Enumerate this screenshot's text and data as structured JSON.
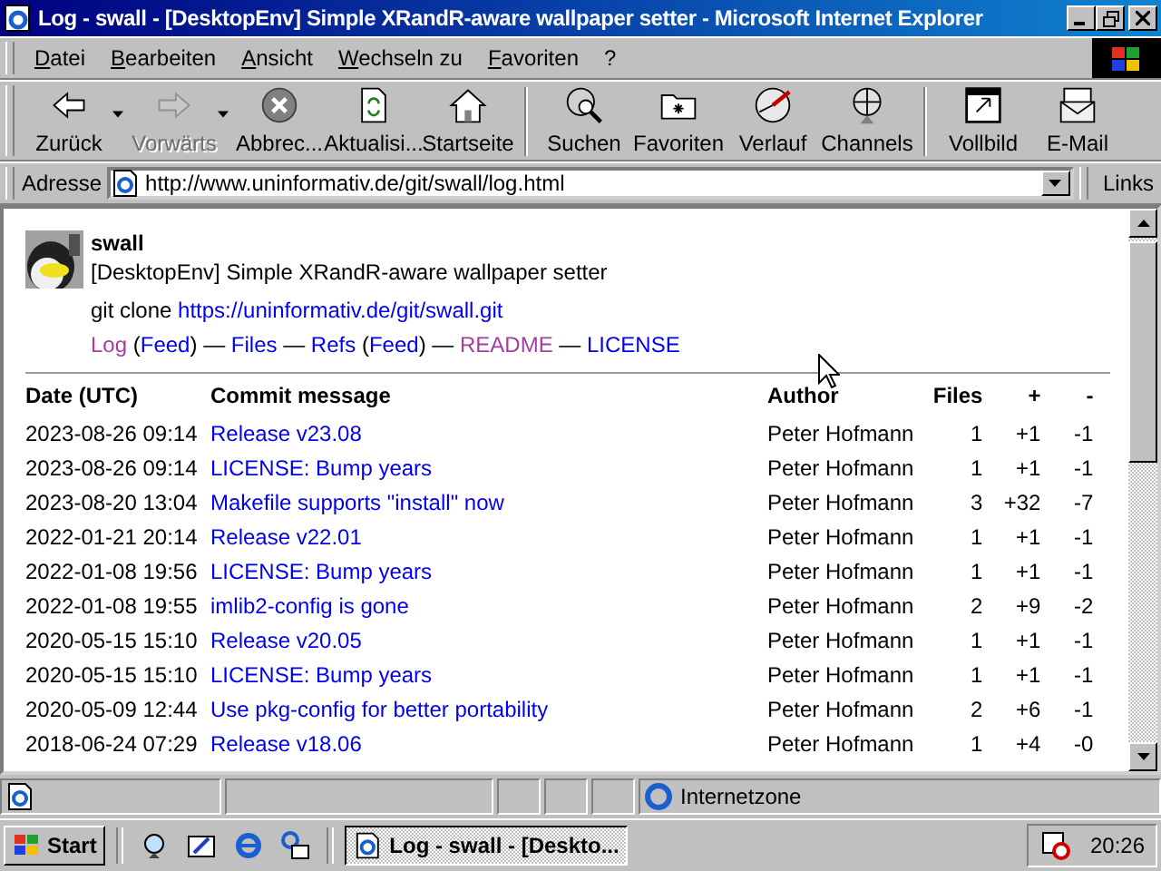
{
  "window": {
    "title": "Log - swall - [DesktopEnv] Simple XRandR-aware wallpaper setter - Microsoft Internet Explorer"
  },
  "menu": [
    "Datei",
    "Bearbeiten",
    "Ansicht",
    "Wechseln zu",
    "Favoriten",
    "?"
  ],
  "toolbar": [
    {
      "label": "Zurück",
      "disabled": false,
      "dropdown": true
    },
    {
      "label": "Vorwärts",
      "disabled": true,
      "dropdown": true
    },
    {
      "label": "Abbrec...",
      "disabled": false
    },
    {
      "label": "Aktualisi...",
      "disabled": false
    },
    {
      "label": "Startseite",
      "disabled": false
    },
    {
      "label": "Suchen",
      "disabled": false,
      "group_start": true
    },
    {
      "label": "Favoriten",
      "disabled": false
    },
    {
      "label": "Verlauf",
      "disabled": false
    },
    {
      "label": "Channels",
      "disabled": false
    },
    {
      "label": "Vollbild",
      "disabled": false,
      "group_start": true
    },
    {
      "label": "E-Mail",
      "disabled": false
    }
  ],
  "address_bar": {
    "label": "Adresse",
    "value": "http://www.uninformativ.de/git/swall/log.html",
    "links": "Links"
  },
  "page": {
    "repo_name": "swall",
    "description": "[DesktopEnv] Simple XRandR-aware wallpaper setter",
    "clone_label": "git clone ",
    "clone_url": "https://uninformativ.de/git/swall.git",
    "nav": [
      {
        "text": "Log",
        "kind": "visited"
      },
      {
        "text": " (",
        "kind": "plain"
      },
      {
        "text": "Feed",
        "kind": "link"
      },
      {
        "text": ") — ",
        "kind": "plain"
      },
      {
        "text": "Files",
        "kind": "link"
      },
      {
        "text": " — ",
        "kind": "plain"
      },
      {
        "text": "Refs",
        "kind": "link"
      },
      {
        "text": " (",
        "kind": "plain"
      },
      {
        "text": "Feed",
        "kind": "link"
      },
      {
        "text": ") — ",
        "kind": "plain"
      },
      {
        "text": "README",
        "kind": "visited"
      },
      {
        "text": " — ",
        "kind": "plain"
      },
      {
        "text": "LICENSE",
        "kind": "link"
      }
    ],
    "table": {
      "columns": [
        "Date (UTC)",
        "Commit message",
        "Author",
        "Files",
        "+",
        "-"
      ],
      "rows": [
        [
          "2023-08-26 09:14",
          "Release v23.08",
          "Peter Hofmann",
          "1",
          "+1",
          "-1"
        ],
        [
          "2023-08-26 09:14",
          "LICENSE: Bump years",
          "Peter Hofmann",
          "1",
          "+1",
          "-1"
        ],
        [
          "2023-08-20 13:04",
          "Makefile supports \"install\" now",
          "Peter Hofmann",
          "3",
          "+32",
          "-7"
        ],
        [
          "2022-01-21 20:14",
          "Release v22.01",
          "Peter Hofmann",
          "1",
          "+1",
          "-1"
        ],
        [
          "2022-01-08 19:56",
          "LICENSE: Bump years",
          "Peter Hofmann",
          "1",
          "+1",
          "-1"
        ],
        [
          "2022-01-08 19:55",
          "imlib2-config is gone",
          "Peter Hofmann",
          "2",
          "+9",
          "-2"
        ],
        [
          "2020-05-15 15:10",
          "Release v20.05",
          "Peter Hofmann",
          "1",
          "+1",
          "-1"
        ],
        [
          "2020-05-15 15:10",
          "LICENSE: Bump years",
          "Peter Hofmann",
          "1",
          "+1",
          "-1"
        ],
        [
          "2020-05-09 12:44",
          "Use pkg-config for better portability",
          "Peter Hofmann",
          "2",
          "+6",
          "-1"
        ],
        [
          "2018-06-24 07:29",
          "Release v18.06",
          "Peter Hofmann",
          "1",
          "+4",
          "-0"
        ]
      ]
    }
  },
  "status_bar": {
    "zone": "Internetzone"
  },
  "taskbar": {
    "start": "Start",
    "task": "Log - swall - [Deskto...",
    "clock": "20:26"
  }
}
